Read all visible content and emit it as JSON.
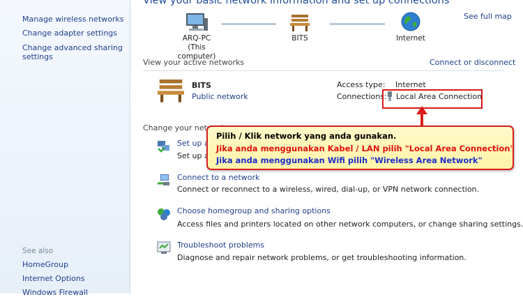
{
  "sidebar": {
    "links": [
      "Manage wireless networks",
      "Change adapter settings",
      "Change advanced sharing",
      "settings"
    ],
    "see_also_label": "See also",
    "see_also": [
      "HomeGroup",
      "Internet Options",
      "Windows Firewall"
    ]
  },
  "header": {
    "title": "View your basic network information and set up connections",
    "see_full_map": "See full map"
  },
  "map": {
    "computer_name": "ARQ-PC",
    "computer_sub": "(This computer)",
    "network_name": "BITS",
    "internet": "Internet"
  },
  "active": {
    "heading": "View your active networks",
    "connect_disconnect": "Connect or disconnect",
    "network_name": "BITS",
    "network_type": "Public network",
    "access_type_label": "Access type:",
    "access_type_value": "Internet",
    "connections_label": "Connections:",
    "connection_value": "Local Area Connection"
  },
  "change": {
    "heading": "Change your network",
    "tasks": [
      {
        "title": "Set up a",
        "desc": "Set up a"
      },
      {
        "title": "Connect to a network",
        "desc": "Connect or reconnect to a wireless, wired, dial-up, or VPN network connection."
      },
      {
        "title": "Choose homegroup and sharing options",
        "desc": "Access files and printers located on other network computers, or change sharing settings."
      },
      {
        "title": "Troubleshoot problems",
        "desc": "Diagnose and repair network problems, or get troubleshooting information."
      }
    ]
  },
  "callout": {
    "line1": "Pilih / Klik network yang anda gunakan.",
    "line2": "Jika anda menggunakan Kabel / LAN pilih \"Local Area Connection\"",
    "line3": "Jika anda menggunakan Wifi pilih \"Wireless Area Network\"",
    "color_line1": "#000000",
    "color_line2": "#e01010",
    "color_line3": "#1a2ec8"
  }
}
